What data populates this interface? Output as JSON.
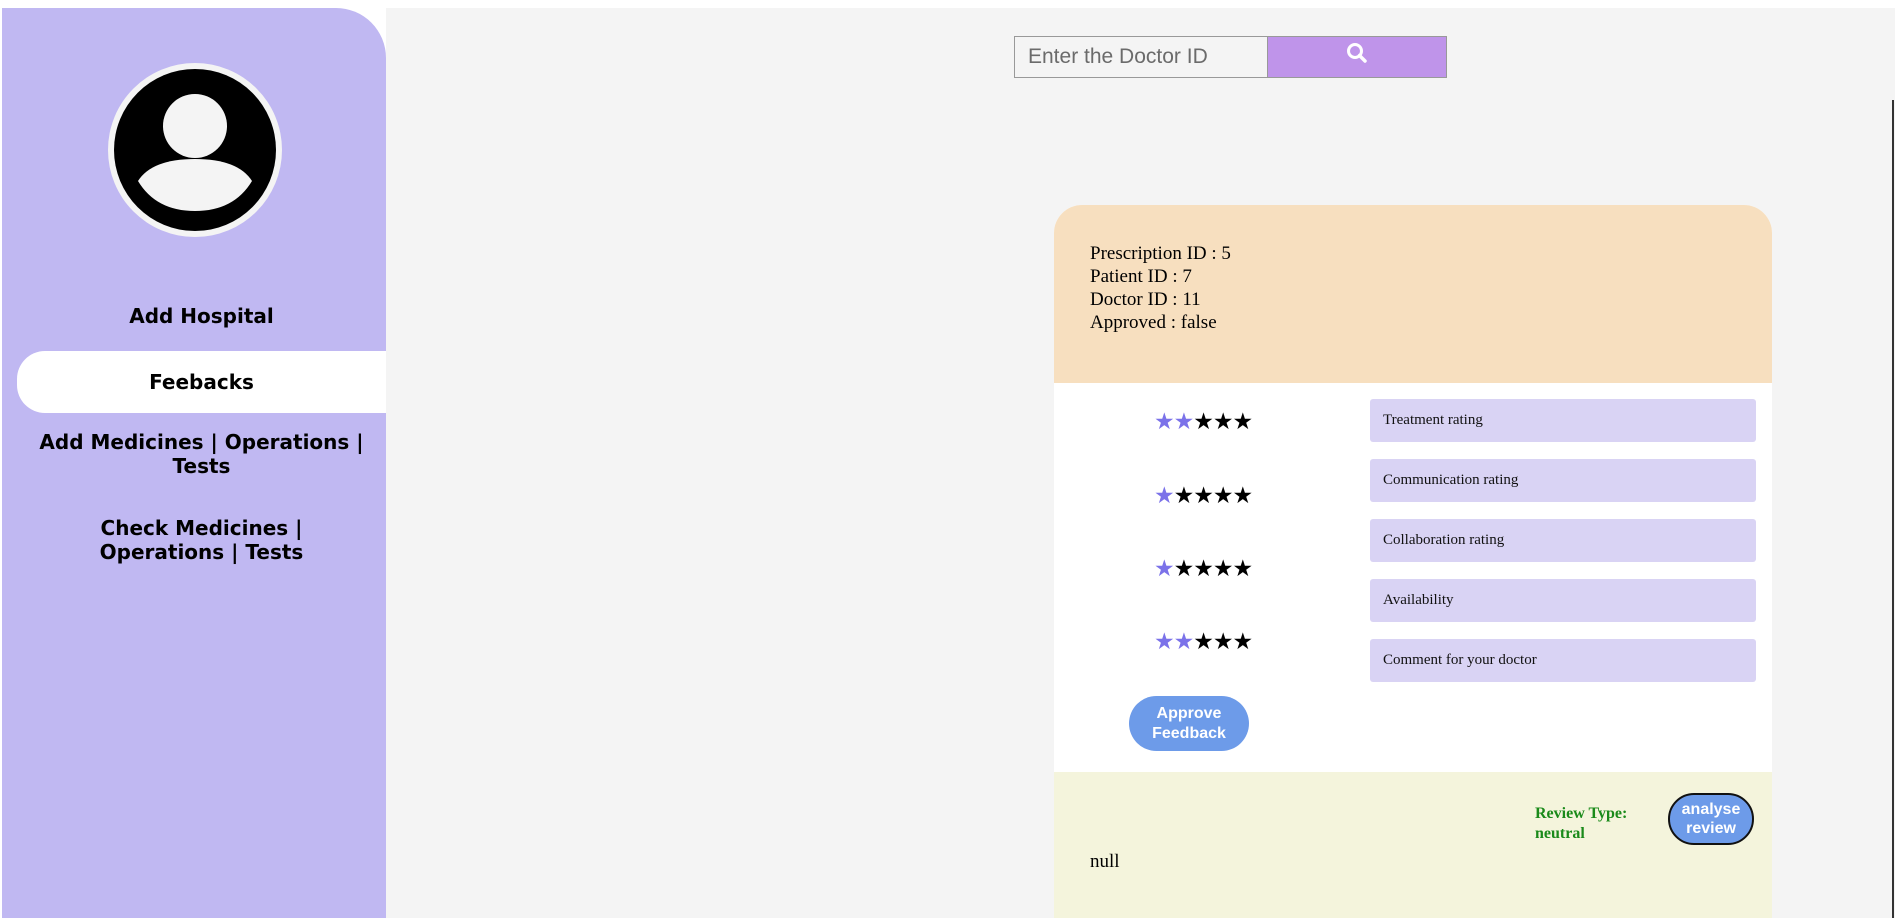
{
  "sidebar": {
    "avatar_icon": "user-avatar-icon",
    "items": [
      {
        "label": "Add Hospital",
        "active": false
      },
      {
        "label": "Feebacks",
        "active": true
      },
      {
        "label": "Add Medicines | Operations | Tests",
        "active": false
      },
      {
        "label": "Check Medicines | Operations | Tests",
        "active": false
      }
    ]
  },
  "search": {
    "placeholder": "Enter the Doctor ID",
    "value": "",
    "button_icon": "search-icon"
  },
  "feedback_card": {
    "info": {
      "prescription": "Prescription ID : 5",
      "patient": "Patient ID : 7",
      "doctor": "Doctor ID : 11",
      "approved": "Approved : false"
    },
    "ratings": [
      {
        "stars_filled": 2,
        "stars_total": 5
      },
      {
        "stars_filled": 1,
        "stars_total": 5
      },
      {
        "stars_filled": 1,
        "stars_total": 5
      },
      {
        "stars_filled": 2,
        "stars_total": 5
      }
    ],
    "fields": [
      "Treatment rating",
      "Communication rating",
      "Collaboration rating",
      "Availability",
      "Comment for your doctor"
    ],
    "approve_label": "Approve Feedback",
    "review_type_label": "Review Type:",
    "review_type_value": "neutral",
    "analyse_label": "analyse review",
    "comment": "null"
  },
  "colors": {
    "sidebar_bg": "#c0b8f2",
    "card_header_bg": "#f7dfbf",
    "card_footer_bg": "#f4f4dc",
    "field_bg": "#d9d3f4",
    "button_bg": "#6d9be9",
    "search_button_bg": "#bf94ea",
    "star_filled": "#7b72e9",
    "review_type_color": "#1a8a1a"
  }
}
